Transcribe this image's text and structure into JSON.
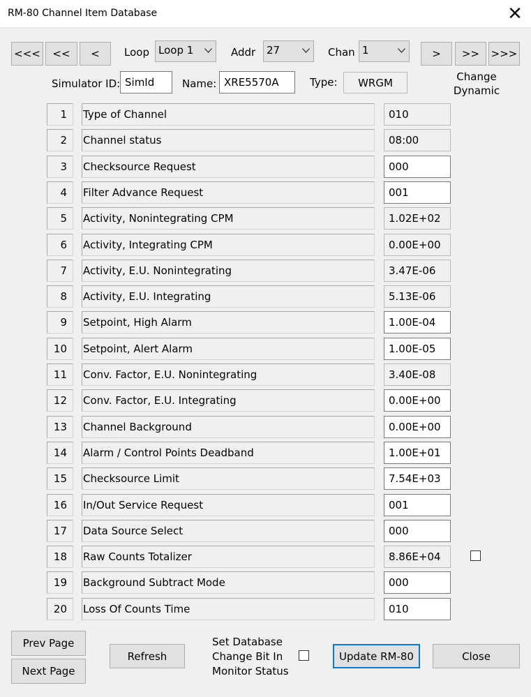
{
  "window": {
    "title": "RM-80 Channel Item Database",
    "close_glyph": "✕"
  },
  "nav": {
    "first": "<<<",
    "prev_many": "<<",
    "prev": "<",
    "next": ">",
    "next_many": ">>",
    "last": ">>>"
  },
  "loop": {
    "label": "Loop",
    "value": "Loop 1"
  },
  "addr": {
    "label": "Addr",
    "value": "27"
  },
  "chan": {
    "label": "Chan",
    "value": "1"
  },
  "change_dynamic": {
    "line1": "Change",
    "line2": "Dynamic"
  },
  "sim": {
    "label": "Simulator ID:",
    "value": "SimId"
  },
  "name": {
    "label": "Name:",
    "value": "XRE5570A"
  },
  "type": {
    "label": "Type:",
    "value": "WRGM"
  },
  "items": [
    {
      "num": "1",
      "name": "Type of Channel",
      "value": "010"
    },
    {
      "num": "2",
      "name": "Channel status",
      "value": "08:00"
    },
    {
      "num": "3",
      "name": "Checksource Request",
      "value": "000"
    },
    {
      "num": "4",
      "name": "Filter Advance Request",
      "value": "001"
    },
    {
      "num": "5",
      "name": "Activity, Nonintegrating CPM",
      "value": "1.02E+02"
    },
    {
      "num": "6",
      "name": "Activity, Integrating CPM",
      "value": "0.00E+00"
    },
    {
      "num": "7",
      "name": "Activity, E.U. Nonintegrating",
      "value": "3.47E-06"
    },
    {
      "num": "8",
      "name": "Activity, E.U. Integrating",
      "value": "5.13E-06"
    },
    {
      "num": "9",
      "name": "Setpoint, High Alarm",
      "value": "1.00E-04"
    },
    {
      "num": "10",
      "name": "Setpoint, Alert Alarm",
      "value": "1.00E-05"
    },
    {
      "num": "11",
      "name": "Conv. Factor, E.U. Nonintegrating",
      "value": "3.40E-08"
    },
    {
      "num": "12",
      "name": "Conv. Factor, E.U. Integrating",
      "value": "0.00E+00"
    },
    {
      "num": "13",
      "name": "Channel Background",
      "value": "0.00E+00"
    },
    {
      "num": "14",
      "name": "Alarm / Control Points Deadband",
      "value": "1.00E+01"
    },
    {
      "num": "15",
      "name": "Checksource Limit",
      "value": "7.54E+03"
    },
    {
      "num": "16",
      "name": "In/Out Service Request",
      "value": "001"
    },
    {
      "num": "17",
      "name": "Data Source Select",
      "value": "000"
    },
    {
      "num": "18",
      "name": "Raw Counts Totalizer",
      "value": "8.86E+04"
    },
    {
      "num": "19",
      "name": "Background Subtract Mode",
      "value": "000"
    },
    {
      "num": "20",
      "name": "Loss Of Counts Time",
      "value": "010"
    }
  ],
  "buttons": {
    "prev_page": "Prev Page",
    "next_page": "Next Page",
    "refresh": "Refresh",
    "update": "Update RM-80",
    "close": "Close"
  },
  "set_db": {
    "line1": "Set Database",
    "line2": "Change Bit In",
    "line3": "Monitor Status"
  }
}
